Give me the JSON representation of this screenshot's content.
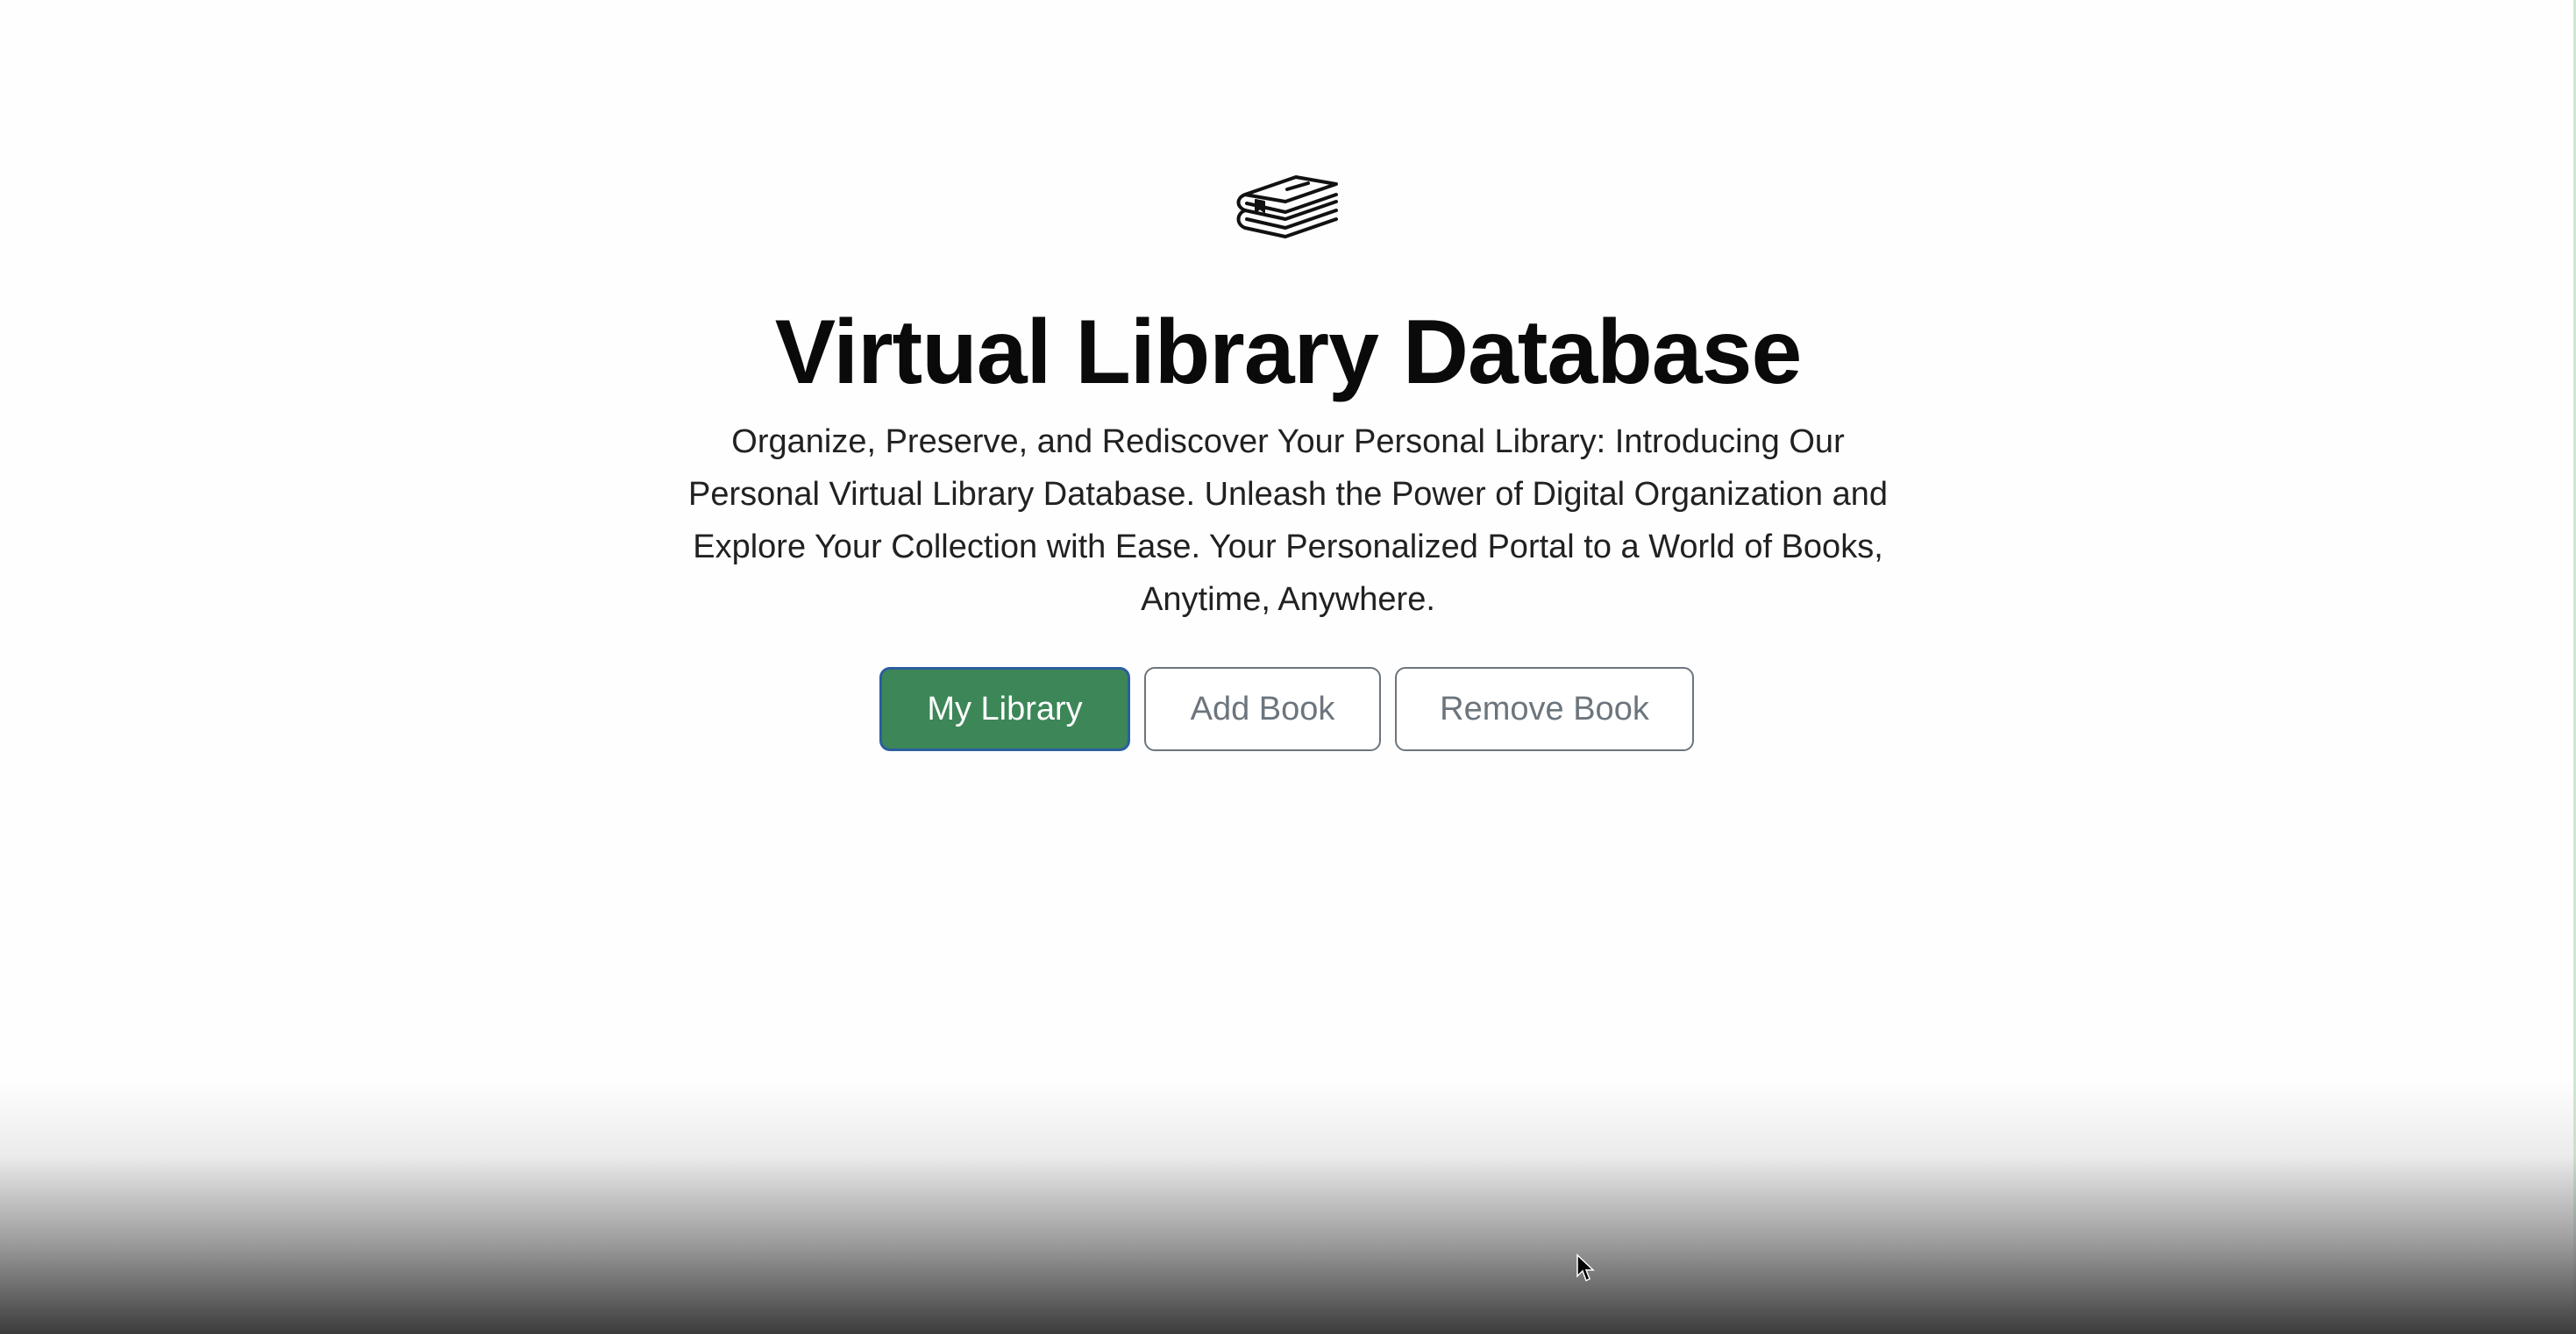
{
  "hero": {
    "title": "Virtual Library Database",
    "description": "Organize, Preserve, and Rediscover Your Personal Library: Introducing Our Personal Virtual Library Database. Unleash the Power of Digital Organization and Explore Your Collection with Ease. Your Personalized Portal to a World of Books, Anytime, Anywhere.",
    "logo_icon": "books-stack-icon"
  },
  "actions": {
    "my_library_label": "My Library",
    "add_book_label": "Add Book",
    "remove_book_label": "Remove Book"
  },
  "colors": {
    "primary": "#3d8658",
    "primary_border": "#2a5e9e",
    "outline": "#6c757d",
    "title": "#0a0a0a"
  }
}
